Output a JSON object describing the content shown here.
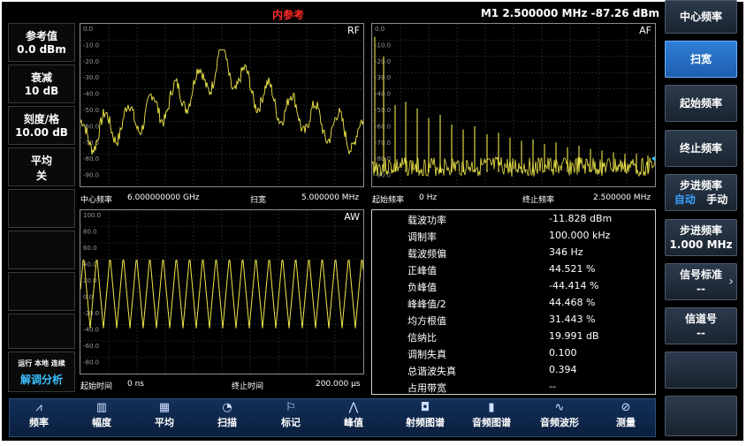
{
  "status": {
    "reference": "内参考",
    "marker": "M1  2.500000 MHz   -87.26 dBm"
  },
  "left_panel": [
    {
      "l1": "参考值",
      "l2": "0.0 dBm"
    },
    {
      "l1": "衰减",
      "l2": "10 dB"
    },
    {
      "l1": "刻度/格",
      "l2": "10.00 dB"
    },
    {
      "l1": "平均",
      "l2": "关"
    }
  ],
  "left_bottom": {
    "status": "运行 本地 连续",
    "mode": "解调分析"
  },
  "rf": {
    "tag": "RF",
    "yticks": [
      "0.0",
      "-10.0",
      "-20.0",
      "-30.0",
      "-40.0",
      "-50.0",
      "-60.0",
      "-70.0",
      "-80.0",
      "-90.0"
    ],
    "center_label": "中心频率",
    "center_value": "6.000000000 GHz",
    "span_label": "扫宽",
    "span_value": "5.000000 MHz"
  },
  "af": {
    "tag": "AF",
    "yticks": [
      "0.0",
      "-10.0",
      "-20.0",
      "-30.0",
      "-40.0",
      "-50.0",
      "-60.0",
      "-70.0",
      "-80.0",
      "-90.0"
    ],
    "start_label": "起始频率",
    "start_value": "0 Hz",
    "stop_label": "终止频率",
    "stop_value": "2.500000 MHz"
  },
  "aw": {
    "tag": "AW",
    "yticks": [
      "100.0",
      "80.0",
      "60.0",
      "40.0",
      "20.0",
      "0.0",
      "-20.0",
      "-40.0",
      "-60.0",
      "-80.0"
    ],
    "start_label": "起始时间",
    "start_value": "0 ns",
    "stop_label": "终止时间",
    "stop_value": "200.000 µs"
  },
  "measurements": [
    {
      "k": "载波功率",
      "v": "-11.828 dBm"
    },
    {
      "k": "调制率",
      "v": "100.000 kHz"
    },
    {
      "k": "载波频偏",
      "v": "346 Hz"
    },
    {
      "k": "正峰值",
      "v": "44.521 %"
    },
    {
      "k": "负峰值",
      "v": "-44.414 %"
    },
    {
      "k": "峰峰值/2",
      "v": "44.468 %"
    },
    {
      "k": "均方根值",
      "v": "31.443 %"
    },
    {
      "k": "信纳比",
      "v": "19.991 dB"
    },
    {
      "k": "调制失真",
      "v": "0.100"
    },
    {
      "k": "总谐波失真",
      "v": "0.394"
    },
    {
      "k": "占用带宽",
      "v": "--"
    }
  ],
  "softkeys": {
    "center": "中心频率",
    "span": "扫宽",
    "start": "起始频率",
    "stop": "终止频率",
    "step": {
      "label": "步进频率",
      "auto": "自动",
      "manual": "手动"
    },
    "step_value": {
      "label": "步进频率",
      "value": "1.000 MHz"
    },
    "signal_std": {
      "label": "信号标准",
      "value": "--"
    },
    "channel": {
      "label": "信道号",
      "value": "--"
    }
  },
  "bottom_menu": [
    {
      "label": "频率",
      "icon": "freq-icon",
      "glyph": "⩘"
    },
    {
      "label": "幅度",
      "icon": "amplitude-icon",
      "glyph": "▥"
    },
    {
      "label": "平均",
      "icon": "average-icon",
      "glyph": "▦"
    },
    {
      "label": "扫描",
      "icon": "sweep-icon",
      "glyph": "◔"
    },
    {
      "label": "标记",
      "icon": "marker-icon",
      "glyph": "⚐"
    },
    {
      "label": "峰值",
      "icon": "peak-icon",
      "glyph": "⋀"
    },
    {
      "label": "射频图谱",
      "icon": "rf-spectrum-icon",
      "glyph": "◘"
    },
    {
      "label": "音频图谱",
      "icon": "audio-spectrum-icon",
      "glyph": "▮"
    },
    {
      "label": "音频波形",
      "icon": "audio-wave-icon",
      "glyph": "∿"
    },
    {
      "label": "测量",
      "icon": "measure-icon",
      "glyph": "⊘"
    }
  ],
  "colors": {
    "trace": "#f0e84a",
    "grid": "#3a3a3a",
    "reference": "#ff2a2a",
    "active_key": "#2f7fd6"
  }
}
